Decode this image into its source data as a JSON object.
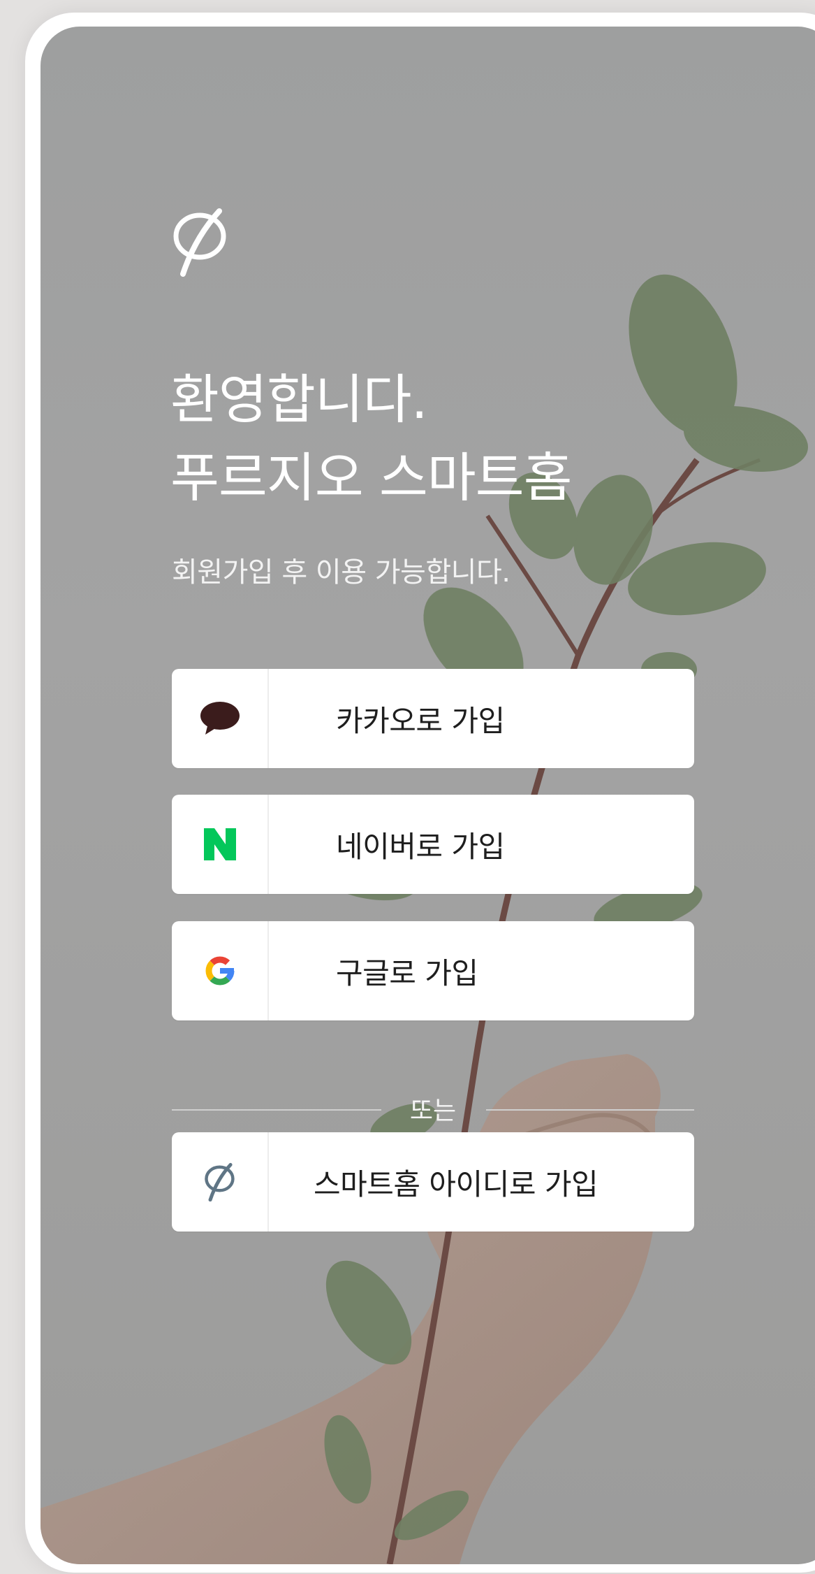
{
  "welcome": {
    "title_line1": "환영합니다.",
    "title_line2": "푸르지오 스마트홈",
    "subtitle": "회원가입 후 이용 가능합니다."
  },
  "signup_buttons": [
    {
      "label": "카카오로 가입",
      "icon": "kakao-speech-bubble-icon",
      "icon_color": "#3b1c1c"
    },
    {
      "label": "네이버로 가입",
      "icon": "naver-n-icon",
      "icon_color": "#03c75a"
    },
    {
      "label": "구글로 가입",
      "icon": "google-g-icon",
      "icon_color": "#4285f4"
    }
  ],
  "divider": {
    "text": "또는"
  },
  "smarthome_button": {
    "label": "스마트홈 아이디로 가입",
    "icon": "prugio-logo-icon",
    "icon_color": "#5f7585"
  },
  "colors": {
    "background_overlay": "#a0a0a0",
    "button_bg": "#ffffff",
    "text_white": "#ffffff"
  }
}
